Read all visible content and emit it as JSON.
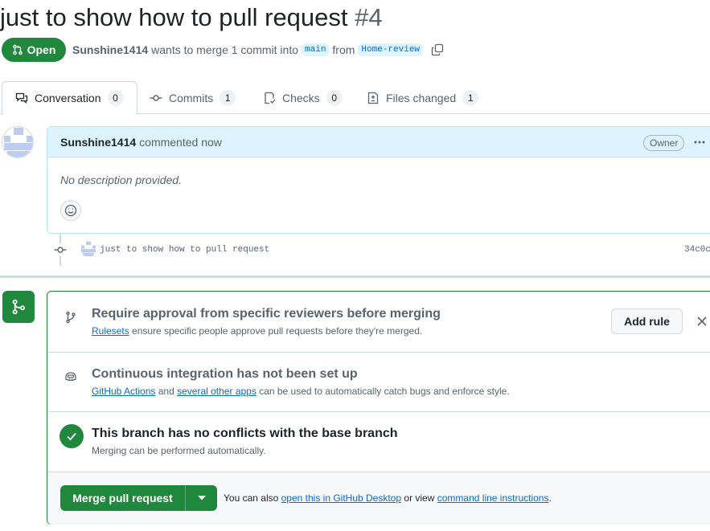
{
  "pr": {
    "title": "just to show how to pull request",
    "number": "#4",
    "state": "Open",
    "author": "Sunshine1414",
    "meta_text": "wants to merge 1 commit into",
    "base_branch": "main",
    "from_text": "from",
    "head_branch": "Home-review"
  },
  "tabs": [
    {
      "label": "Conversation",
      "count": "0",
      "icon": "comment-discussion-icon"
    },
    {
      "label": "Commits",
      "count": "1",
      "icon": "git-commit-icon"
    },
    {
      "label": "Checks",
      "count": "0",
      "icon": "checklist-icon"
    },
    {
      "label": "Files changed",
      "count": "1",
      "icon": "file-diff-icon"
    }
  ],
  "comment": {
    "author": "Sunshine1414",
    "action": "commented now",
    "badge": "Owner",
    "body": "No description provided."
  },
  "commit": {
    "message": "just to show how to pull request",
    "sha": "34c0c"
  },
  "merge_box": {
    "rules": {
      "title": "Require approval from specific reviewers before merging",
      "link": "Rulesets",
      "text": "ensure specific people approve pull requests before they're merged.",
      "button": "Add rule"
    },
    "ci": {
      "title": "Continuous integration has not been set up",
      "link1": "GitHub Actions",
      "and_text": "and",
      "link2": "several other apps",
      "text": "can be used to automatically catch bugs and enforce style."
    },
    "conflicts": {
      "title": "This branch has no conflicts with the base branch",
      "text": "Merging can be performed automatically."
    },
    "footer": {
      "button": "Merge pull request",
      "prefix": "You can also",
      "link1": "open this in GitHub Desktop",
      "middle": "or view",
      "link2": "command line instructions",
      "suffix": "."
    }
  },
  "colors": {
    "green": "#1f883d",
    "blue_link": "#0969da",
    "comment_header": "#ddf4ff",
    "muted": "#59636e"
  }
}
